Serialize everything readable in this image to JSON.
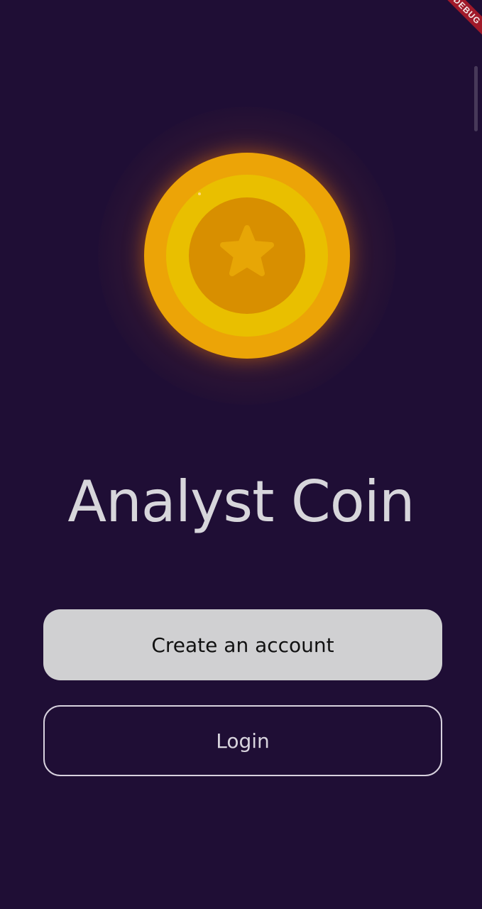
{
  "app": {
    "debug_label": "DEBUG",
    "title": "Analyst Coin"
  },
  "actions": {
    "create_account_label": "Create an account",
    "login_label": "Login"
  },
  "icons": {
    "coin": "coin-icon",
    "star": "star-icon"
  },
  "colors": {
    "background": "#1f0e35",
    "title": "#d7d6db",
    "primary_button": "#d0d0d2",
    "coin_outer": "#eca407",
    "coin_ring": "#e9bf00",
    "coin_inner": "#d88f00"
  }
}
